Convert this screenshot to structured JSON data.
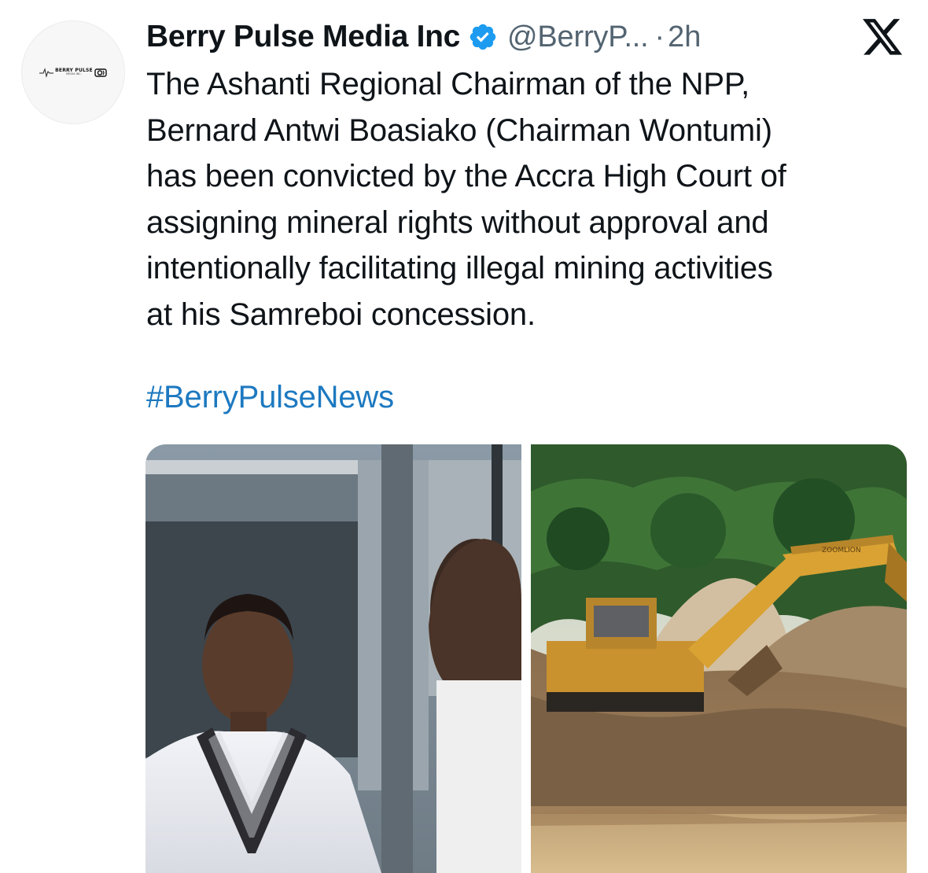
{
  "tweet": {
    "display_name": "Berry Pulse Media Inc",
    "handle": "@BerryP...",
    "separator": "·",
    "time": "2h",
    "text": "The Ashanti Regional Chairman of the NPP,\nBernard Antwi Boasiako (Chairman Wontumi)\nhas been convicted by the Accra High Court of\nassigning mineral rights without approval and\nintentionally facilitating illegal mining activities\nat his Samreboi concession.",
    "hashtag": "#BerryPulseNews"
  },
  "avatar": {
    "logo_text": "BERRY PULSE",
    "logo_subtext": "MEDIA INC."
  },
  "icons": {
    "verified": "verified-badge-icon",
    "platform": "x-logo-icon"
  },
  "media": {
    "images": [
      {
        "name": "man-in-white-outfit-photo"
      },
      {
        "name": "excavator-mining-site-photo",
        "machine_label": "ZOOMLION"
      }
    ]
  },
  "colors": {
    "text": "#0f1419",
    "secondary": "#536471",
    "link": "#1d79c0",
    "verified": "#1d9bf0"
  }
}
